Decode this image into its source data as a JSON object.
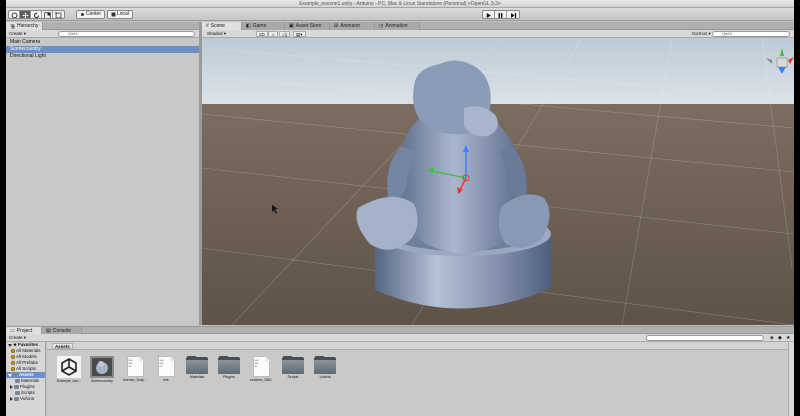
{
  "window": {
    "title": "Example_escene1.unity - Arduino - PC, Mac & Linux Standalone (Personal) <OpenGL 3.3>"
  },
  "toolbar": {
    "tools": [
      "hand-tool",
      "move-tool",
      "rotate-tool",
      "scale-tool",
      "rect-tool"
    ],
    "pivot_label": "Center",
    "space_label": "Local",
    "play_buttons": [
      "play",
      "pause",
      "step"
    ]
  },
  "hierarchy": {
    "tab_label": "Hierarchy",
    "create_label": "Create",
    "search_placeholder": "Q▾All",
    "items": [
      {
        "label": "Main Camera",
        "selected": false
      },
      {
        "label": "Scenecountry",
        "selected": true
      },
      {
        "label": "Directional Light",
        "selected": false
      }
    ]
  },
  "scene": {
    "tabs": [
      {
        "label": "Scene",
        "active": true
      },
      {
        "label": "Game",
        "active": false
      },
      {
        "label": "Asset Store",
        "active": false
      },
      {
        "label": "Animator",
        "active": false
      },
      {
        "label": "Animation",
        "active": false
      }
    ],
    "shading_mode": "Shaded",
    "mode_2d": "2D",
    "gizmos_label": "Gizmos",
    "search_placeholder": "Q▾All",
    "colors": {
      "sky": "#c9d6e0",
      "ground": "#6e5f52",
      "model": "#7f90b0"
    }
  },
  "project": {
    "tabs": [
      {
        "label": "Project",
        "active": true
      },
      {
        "label": "Console",
        "active": false
      }
    ],
    "create_label": "Create",
    "sidebar": [
      {
        "label": "Favorites",
        "kind": "header"
      },
      {
        "label": "All Materials",
        "kind": "favorite"
      },
      {
        "label": "All Models",
        "kind": "favorite"
      },
      {
        "label": "All Prefabs",
        "kind": "favorite"
      },
      {
        "label": "All Scripts",
        "kind": "favorite"
      },
      {
        "label": "Assets",
        "kind": "root-selected"
      },
      {
        "label": "Materials",
        "kind": "folder"
      },
      {
        "label": "Plugins",
        "kind": "folder-expandable"
      },
      {
        "label": "Scripts",
        "kind": "folder"
      },
      {
        "label": "Vuforia",
        "kind": "folder-expandable"
      }
    ],
    "breadcrumb": "Assets",
    "assets": [
      {
        "label": "Example_esc...",
        "type": "unity"
      },
      {
        "label": "Scenecountry",
        "type": "model"
      },
      {
        "label": "license_3rdp...",
        "type": "doc"
      },
      {
        "label": "link",
        "type": "doc"
      },
      {
        "label": "Materials",
        "type": "folder"
      },
      {
        "label": "Plugins",
        "type": "folder"
      },
      {
        "label": "readme_SDK",
        "type": "doc"
      },
      {
        "label": "Scripts",
        "type": "folder"
      },
      {
        "label": "Vuforia",
        "type": "folder"
      }
    ]
  }
}
